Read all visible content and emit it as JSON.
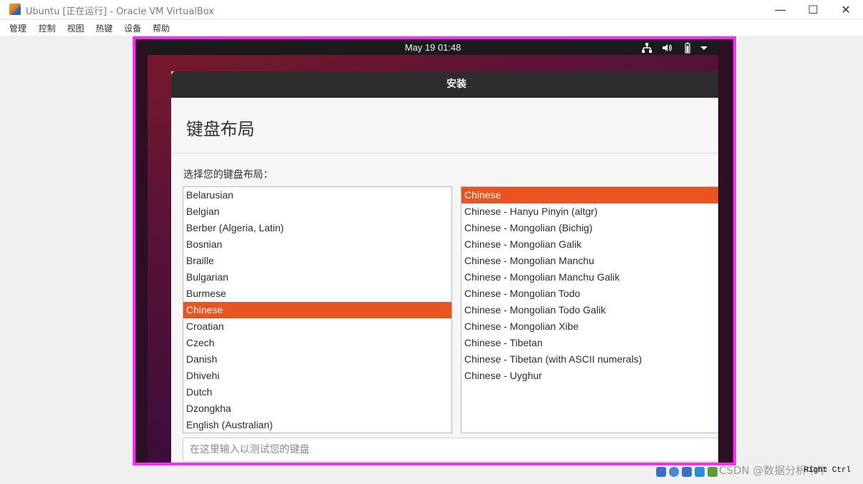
{
  "window": {
    "title": "Ubuntu [正在运行] - Oracle VM VirtualBox",
    "minimize": "—",
    "maximize": "☐",
    "close": "✕"
  },
  "menubar": [
    "管理",
    "控制",
    "视图",
    "热键",
    "设备",
    "帮助"
  ],
  "topbar": {
    "clock": "May 19  01:48",
    "icons": [
      "network-icon",
      "volume-icon",
      "battery-icon",
      "dropdown-arrow-icon"
    ]
  },
  "installer": {
    "window_title": "安装",
    "page_title": "键盘布局",
    "prompt": "选择您的键盘布局：",
    "layouts": [
      "Belarusian",
      "Belgian",
      "Berber (Algeria, Latin)",
      "Bosnian",
      "Braille",
      "Bulgarian",
      "Burmese",
      "Chinese",
      "Croatian",
      "Czech",
      "Danish",
      "Dhivehi",
      "Dutch",
      "Dzongkha",
      "English (Australian)"
    ],
    "selected_layout": "Chinese",
    "variants": [
      "Chinese",
      "Chinese - Hanyu Pinyin (altgr)",
      "Chinese - Mongolian (Bichig)",
      "Chinese - Mongolian Galik",
      "Chinese - Mongolian Manchu",
      "Chinese - Mongolian Manchu Galik",
      "Chinese - Mongolian Todo",
      "Chinese - Mongolian Todo Galik",
      "Chinese - Mongolian Xibe",
      "Chinese - Tibetan",
      "Chinese - Tibetan (with ASCII numerals)",
      "Chinese - Uyghur"
    ],
    "selected_variant": "Chinese",
    "test_placeholder": "在这里输入以测试您的键盘"
  },
  "statusbar": {
    "watermark": "CSDN @数据分析中中",
    "host_key": "Right Ctrl"
  },
  "colors": {
    "selection": "#e95420",
    "highlight_border": "#ff28ff"
  }
}
